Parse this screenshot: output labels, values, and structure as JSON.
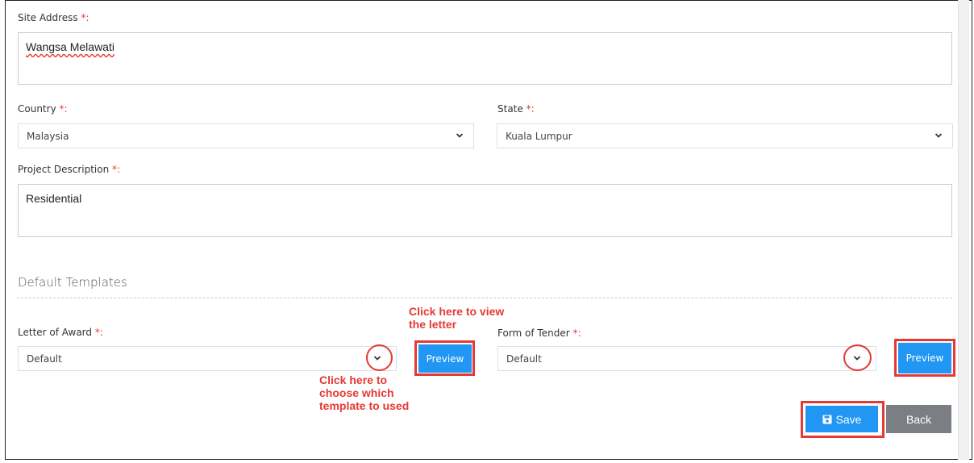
{
  "site_address": {
    "label": "Site Address",
    "required_mark": "*:",
    "value": "Wangsa Melawati"
  },
  "country": {
    "label": "Country",
    "required_mark": "*:",
    "value": "Malaysia"
  },
  "state": {
    "label": "State",
    "required_mark": "*:",
    "value": "Kuala Lumpur"
  },
  "project_description": {
    "label": "Project Description",
    "required_mark": "*:",
    "value": "Residential"
  },
  "default_templates": {
    "title": "Default Templates",
    "letter_of_award": {
      "label": "Letter of Award",
      "required_mark": "*:",
      "value": "Default",
      "preview_label": "Preview"
    },
    "form_of_tender": {
      "label": "Form of Tender",
      "required_mark": "*:",
      "value": "Default",
      "preview_label": "Preview"
    }
  },
  "annotations": {
    "view_letter": [
      "Click here to view",
      "the letter"
    ],
    "choose_template": [
      "Click here to",
      "choose which",
      "template to used"
    ]
  },
  "actions": {
    "save_label": "Save",
    "back_label": "Back"
  },
  "colors": {
    "primary": "#2196f3",
    "annotation": "#e53935",
    "back": "#7b7f84"
  }
}
